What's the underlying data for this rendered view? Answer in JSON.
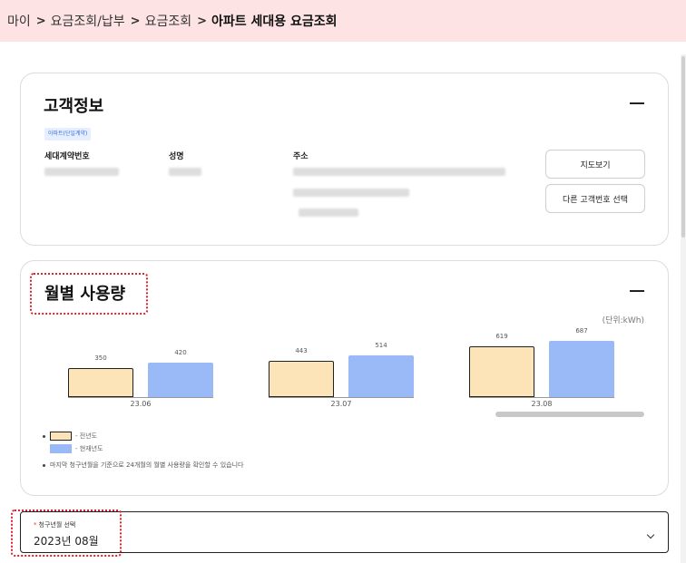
{
  "breadcrumb": {
    "items": [
      "마이",
      "요금조회/납부",
      "요금조회"
    ],
    "current": "아파트 세대용 요금조회"
  },
  "customer": {
    "title": "고객정보",
    "badge": "아파트(단일계약)",
    "labels": {
      "contract_no": "세대계약번호",
      "name": "성명",
      "address": "주소"
    },
    "buttons": {
      "map": "지도보기",
      "other_customer": "다른 고객번호 선택"
    }
  },
  "usage": {
    "title": "월별 사용량",
    "unit": "(단위:kWh)",
    "legend": {
      "prev": "- 전년도",
      "curr": "- 현재년도"
    },
    "note": "마지막 청구년월을 기준으로 24개월의 월별 사용량을 확인할 수 있습니다"
  },
  "chart_data": {
    "type": "bar",
    "categories": [
      "23.06",
      "23.07",
      "23.08"
    ],
    "series": [
      {
        "name": "전년도",
        "values": [
          350,
          443,
          619
        ]
      },
      {
        "name": "현재년도",
        "values": [
          420,
          514,
          687
        ]
      }
    ],
    "ylabel": "(단위:kWh)",
    "colors": {
      "prev": "#fde4b8",
      "curr": "#99baf6"
    }
  },
  "billing_select": {
    "label": "청구년월 선택",
    "required_mark": "*",
    "value": "2023년 08월"
  },
  "colors": {
    "breadcrumb_bg": "#fde3e3",
    "highlight": "#d9242b"
  }
}
